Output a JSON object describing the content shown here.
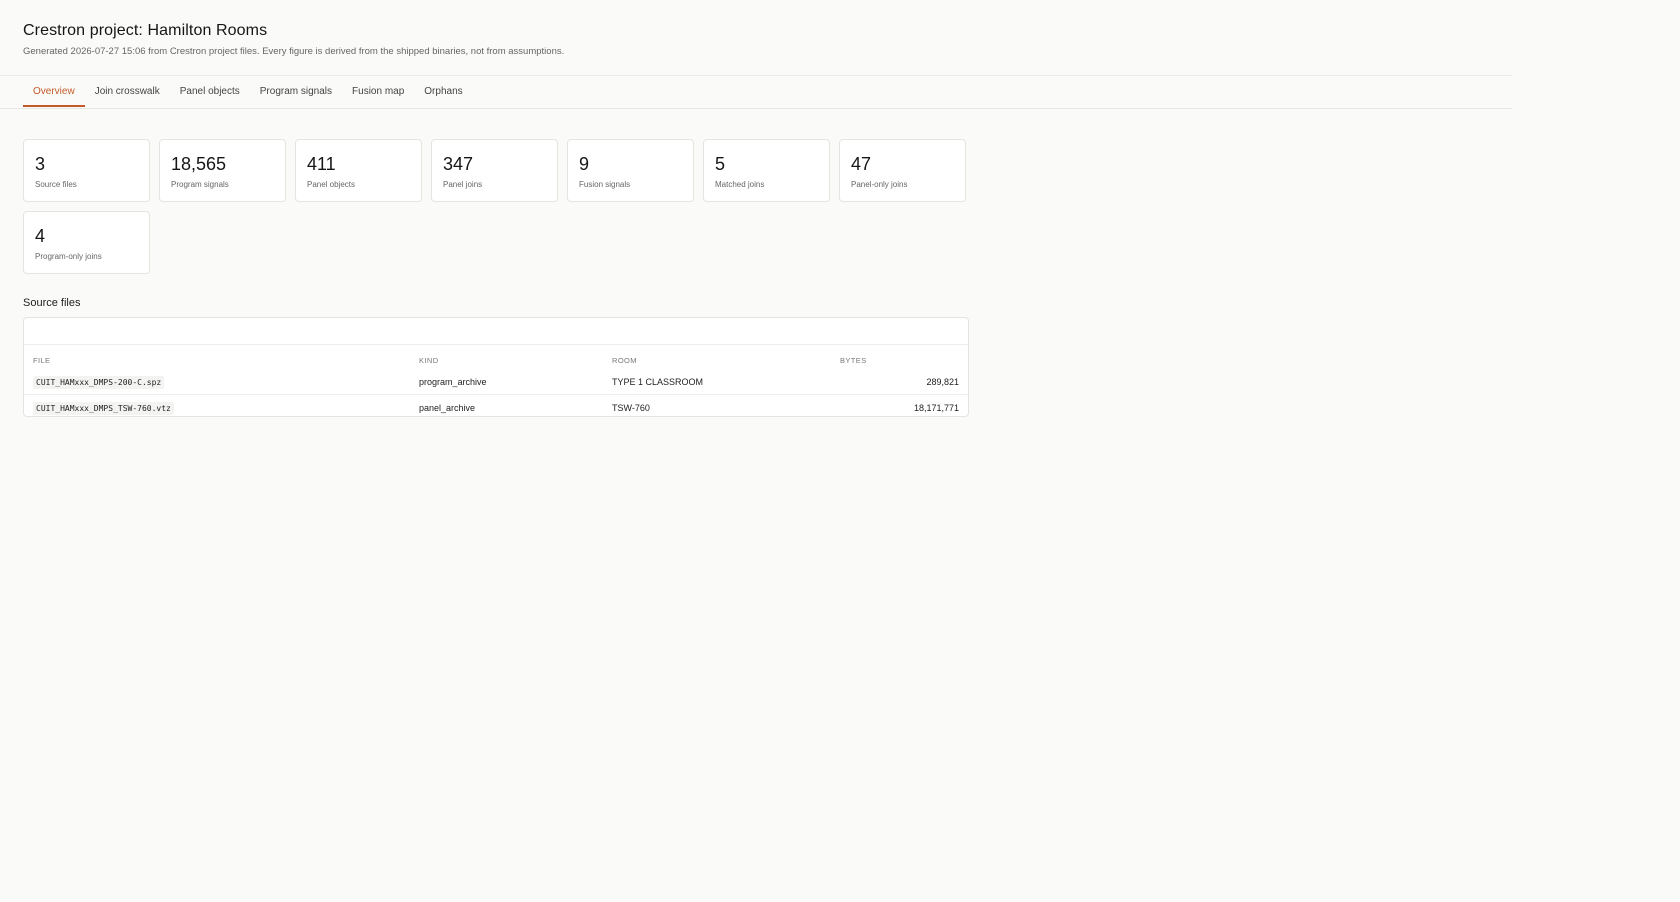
{
  "header": {
    "title": "Crestron project: Hamilton Rooms",
    "subtitle": "Generated 2026-07-27 15:06 from Crestron project files. Every figure is derived from the shipped binaries, not from assumptions."
  },
  "tabs": [
    {
      "label": "Overview",
      "active": true
    },
    {
      "label": "Join crosswalk",
      "active": false
    },
    {
      "label": "Panel objects",
      "active": false
    },
    {
      "label": "Program signals",
      "active": false
    },
    {
      "label": "Fusion map",
      "active": false
    },
    {
      "label": "Orphans",
      "active": false
    }
  ],
  "stats": [
    {
      "value": "3",
      "label": "Source files"
    },
    {
      "value": "18,565",
      "label": "Program signals"
    },
    {
      "value": "411",
      "label": "Panel objects"
    },
    {
      "value": "347",
      "label": "Panel joins"
    },
    {
      "value": "9",
      "label": "Fusion signals"
    },
    {
      "value": "5",
      "label": "Matched joins"
    },
    {
      "value": "47",
      "label": "Panel-only joins"
    },
    {
      "value": "4",
      "label": "Program-only joins"
    }
  ],
  "source_files": {
    "title": "Source files",
    "columns": [
      "FILE",
      "KIND",
      "ROOM",
      "BYTES"
    ],
    "rows": [
      {
        "file": "CUIT_HAMxxx_DMPS-200-C.spz",
        "kind": "program_archive",
        "room": "TYPE 1 CLASSROOM",
        "bytes": "289,821"
      },
      {
        "file": "CUIT_HAMxxx_DMPS_TSW-760.vtz",
        "kind": "panel_archive",
        "room": "TSW-760",
        "bytes": "18,171,771"
      }
    ]
  },
  "colors": {
    "accent": "#c45a28",
    "background": "#fafaf8",
    "card": "#ffffff",
    "border": "#e4e4e1"
  }
}
